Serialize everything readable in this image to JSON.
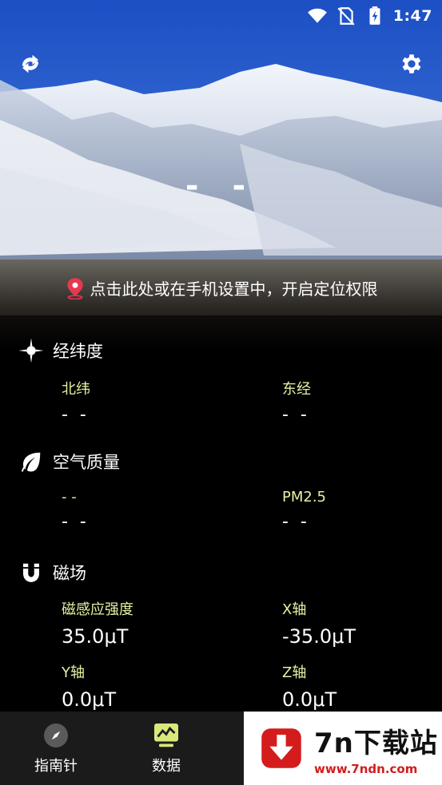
{
  "status_bar": {
    "time": "1:47",
    "icons": [
      "wifi-icon",
      "no-sim-icon",
      "battery-charging-icon"
    ]
  },
  "header": {
    "left_icon": "refresh-icon",
    "right_icon": "gear-icon",
    "main_value": "- -"
  },
  "location_prompt": {
    "icon": "location-pin-icon",
    "text": "点击此处或在手机设置中，开启定位权限"
  },
  "sections": {
    "coordinates": {
      "icon": "crosshair-icon",
      "title": "经纬度",
      "items": [
        {
          "label": "北纬",
          "value": "- -"
        },
        {
          "label": "东经",
          "value": "- -"
        }
      ]
    },
    "air_quality": {
      "icon": "leaf-icon",
      "title": "空气质量",
      "items": [
        {
          "label": "- -",
          "value": "- -"
        },
        {
          "label": "PM2.5",
          "value": "- -"
        }
      ]
    },
    "magnetic": {
      "icon": "magnet-icon",
      "title": "磁场",
      "items": [
        {
          "label": "磁感应强度",
          "value": "35.0μT"
        },
        {
          "label": "X轴",
          "value": "-35.0μT"
        },
        {
          "label": "Y轴",
          "value": "0.0μT"
        },
        {
          "label": "Z轴",
          "value": "0.0μT"
        }
      ]
    }
  },
  "bottom_nav": {
    "items": [
      {
        "icon": "compass-icon",
        "label": "指南针"
      },
      {
        "icon": "chart-monitor-icon",
        "label": "数据"
      }
    ]
  },
  "watermark": {
    "brand": "7n下载站",
    "url": "www.7ndn.com"
  },
  "colors": {
    "label": "#e6f0a2",
    "background": "#000000",
    "nav_background": "#1b1b1b",
    "pin": "#e53950",
    "data_icon": "#d9e87a",
    "watermark_red": "#d41c1c"
  }
}
